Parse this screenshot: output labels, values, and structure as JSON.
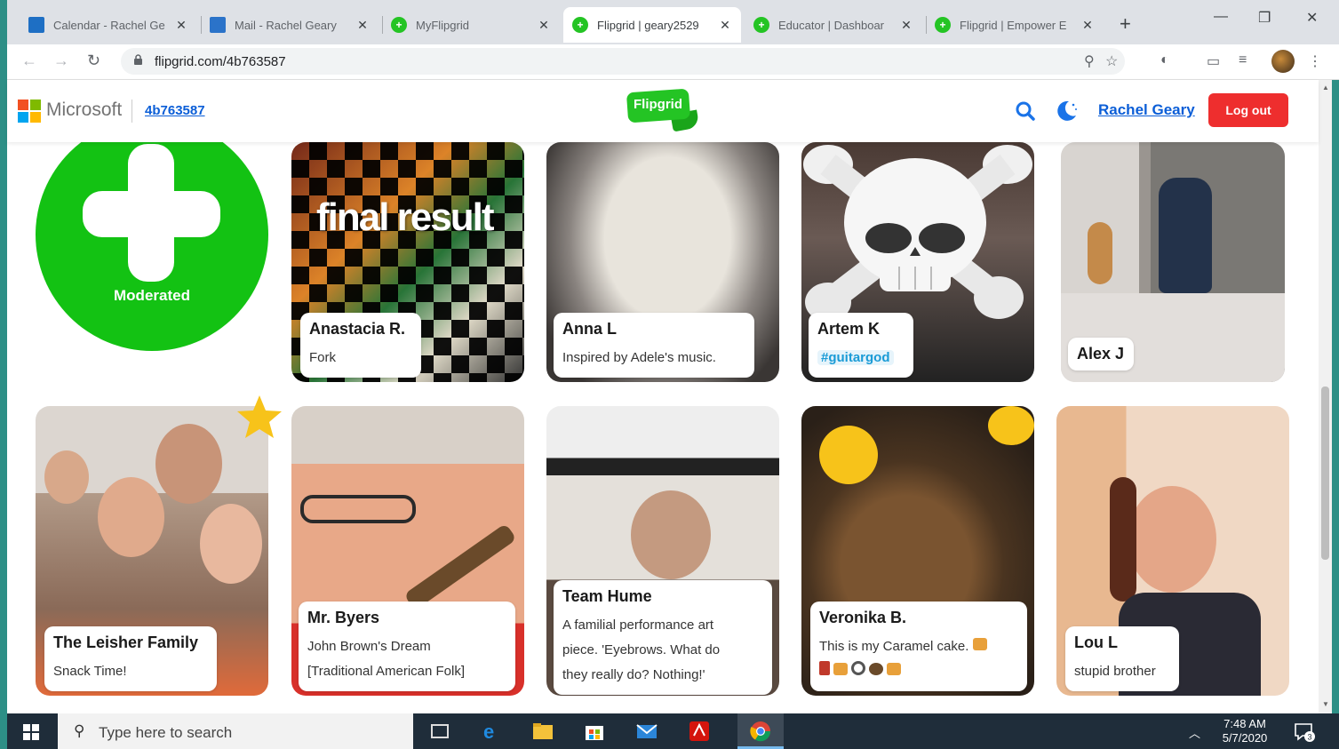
{
  "browser": {
    "tabs": [
      {
        "title": "Calendar - Rachel Ge",
        "icon": "calendar-icon",
        "active": false
      },
      {
        "title": "Mail - Rachel Geary",
        "icon": "outlook-icon",
        "active": false
      },
      {
        "title": "MyFlipgrid",
        "icon": "flipgrid-icon",
        "active": false
      },
      {
        "title": "Flipgrid | geary2529",
        "icon": "flipgrid-icon",
        "active": true
      },
      {
        "title": "Educator | Dashboar",
        "icon": "flipgrid-icon",
        "active": false
      },
      {
        "title": "Flipgrid | Empower E",
        "icon": "flipgrid-icon",
        "active": false
      }
    ],
    "url": "flipgrid.com/4b763587"
  },
  "header": {
    "brand": "Microsoft",
    "grid_code": "4b763587",
    "logo_text": "Flipgrid",
    "user_name": "Rachel Geary",
    "logout_label": "Log out"
  },
  "grid": {
    "add_label": "Moderated",
    "responses": [
      {
        "name": "Anastacia R.",
        "caption": "Fork",
        "overlay_text": "final result"
      },
      {
        "name": "Anna L",
        "caption": "Inspired by Adele's music."
      },
      {
        "name": "Artem K",
        "caption": "#guitargod"
      },
      {
        "name": "Alex J",
        "caption": ""
      },
      {
        "name": "The Leisher Family",
        "caption": "Snack Time!"
      },
      {
        "name": "Mr. Byers",
        "caption": "John Brown's Dream",
        "caption2": "[Traditional American Folk]"
      },
      {
        "name": "Team Hume",
        "caption": "A familial performance art",
        "caption2": "piece. 'Eyebrows. What do",
        "caption3": "they really do? Nothing!'"
      },
      {
        "name": "Veronika B.",
        "caption": "This is my Caramel cake."
      },
      {
        "name": "Lou L",
        "caption": "stupid brother"
      }
    ]
  },
  "taskbar": {
    "search_placeholder": "Type here to search",
    "time": "7:48 AM",
    "date": "5/7/2020",
    "notification_count": "3"
  },
  "colors": {
    "flipgrid_green": "#13c213",
    "logout_red": "#ee2e2e",
    "link_blue": "#0b5ed7"
  }
}
